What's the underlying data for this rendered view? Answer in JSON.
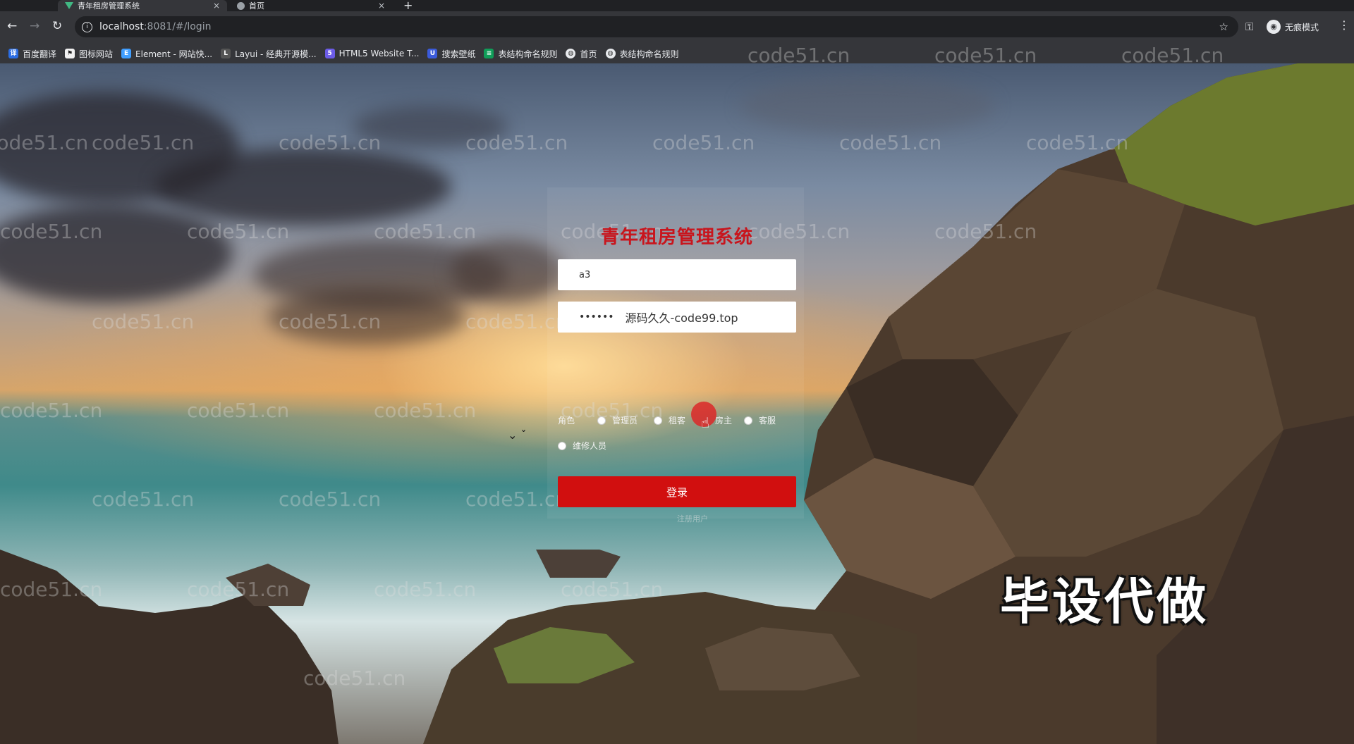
{
  "browser": {
    "tabs": [
      {
        "title": "青年租房管理系统",
        "active": true
      },
      {
        "title": "首页",
        "active": false
      }
    ],
    "new_tab": "+",
    "close_glyph": "×",
    "url_host": "localhost",
    "url_path": ":8081/#/login",
    "profile_label": "无痕模式",
    "bookmarks": [
      {
        "label": "百度翻译",
        "icon": "baidu-translate-icon",
        "color": "#2b6de3"
      },
      {
        "label": "图标网站",
        "icon": "flag-icon",
        "color": "#333333"
      },
      {
        "label": "Element - 网站快...",
        "icon": "element-icon",
        "color": "#409eff"
      },
      {
        "label": "Layui - 经典开源模...",
        "icon": "layui-icon",
        "color": "#555555"
      },
      {
        "label": "HTML5 Website T...",
        "icon": "html5-icon",
        "color": "#6c5ce7"
      },
      {
        "label": "搜索壁纸",
        "icon": "wallpaper-icon",
        "color": "#3b5bdb"
      },
      {
        "label": "表结构命名规则",
        "icon": "sheet-icon",
        "color": "#0f9d58"
      },
      {
        "label": "首页",
        "icon": "globe-icon",
        "color": "#555555"
      },
      {
        "label": "表结构命名规则",
        "icon": "globe-icon",
        "color": "#555555"
      }
    ]
  },
  "login": {
    "title": "青年租房管理系统",
    "username_value": "a3",
    "password_value": "••••••",
    "password_overlay": "源码久久-code99.top",
    "role_label": "角色",
    "roles": [
      "管理员",
      "租客",
      "房主",
      "客服",
      "维修人员"
    ],
    "login_button": "登录",
    "register_link": "注册用户"
  },
  "watermark": "code51.cn",
  "overlay_caption": "毕设代做",
  "colors": {
    "title": "#c8151d",
    "button": "#d10f0f",
    "chrome_dark": "#202124",
    "chrome": "#35363a"
  }
}
